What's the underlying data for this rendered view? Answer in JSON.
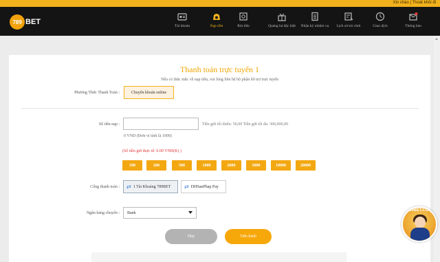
{
  "topbar": {
    "user_text": "Xin chào | Thoát khỏi đi"
  },
  "brand": {
    "badge": "789",
    "name": "BET"
  },
  "nav": [
    {
      "label": "Tài khoản",
      "icon": "account-icon"
    },
    {
      "label": "Nạp tiền",
      "icon": "deposit-icon",
      "active": true
    },
    {
      "label": "Rút tiền",
      "icon": "withdraw-icon"
    },
    {
      "label": "Quảng bá đặc biệt",
      "icon": "promotion-icon"
    },
    {
      "label": "Nhận ký nhiệm vụ",
      "icon": "mission-icon"
    },
    {
      "label": "Lịch sử trò chơi",
      "icon": "game-history-icon"
    },
    {
      "label": "Giao dịch",
      "icon": "transaction-icon"
    },
    {
      "label": "Thông báo",
      "icon": "notification-icon"
    }
  ],
  "form": {
    "title": "Thanh toán trực tuyến 1",
    "subtitle": "Nếu có thắc mắc về nạp tiền, vui lòng liên hệ bộ phận hỗ trợ trực tuyến",
    "method_label": "Phương Thức Thanh Toán :",
    "method_option": "Chuyển khoản online",
    "amount_label": "Số tiền nạp :",
    "amount_value": "",
    "limits": "Tiền gửi tối thiểu: 50,00 Tiền gửi tối đa: 300,000,00",
    "vnd_note": "0 VND (Đơn vị tính là 1000)",
    "balance": "(Số tiền gửi thực tế: 0.00 VNĐ(K) )",
    "chips": [
      "100",
      "200",
      "500",
      "1000",
      "2000",
      "5000",
      "10000",
      "20000"
    ],
    "gateway_label": "Cổng thanh toán :",
    "gateways": [
      {
        "label": "1 Tài Khoảng 789BET",
        "selected": true
      },
      {
        "label": "DHSanPhap Pay",
        "selected": false
      }
    ],
    "bank_label": "Ngân hàng chuyển :",
    "bank_value": "Bank",
    "cancel": "Hủy",
    "submit": "Tiến hành"
  },
  "mascot": {
    "site": "789BET.COM"
  },
  "colors": {
    "accent": "#f2b21c",
    "nav_bg": "#141414",
    "button": "#f6a70a",
    "cancel": "#b3b3b3"
  }
}
